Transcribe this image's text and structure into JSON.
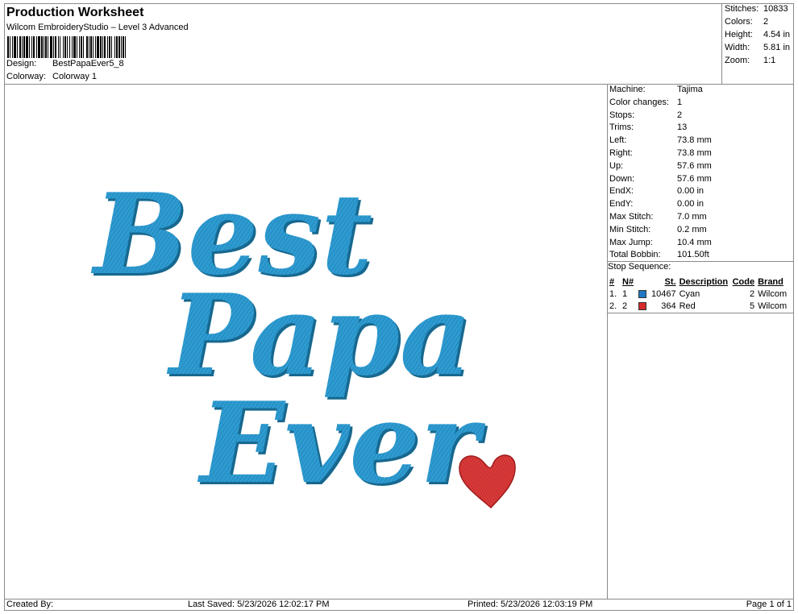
{
  "header": {
    "title": "Production Worksheet",
    "software": "Wilcom EmbroideryStudio – Level 3 Advanced",
    "design_label": "Design:",
    "design_value": "BestPapaEver5_8",
    "colorway_label": "Colorway:",
    "colorway_value": "Colorway 1"
  },
  "summary": {
    "stitches_label": "Stitches:",
    "stitches_value": "10833",
    "colors_label": "Colors:",
    "colors_value": "2",
    "height_label": "Height:",
    "height_value": "4.54 in",
    "width_label": "Width:",
    "width_value": "5.81 in",
    "zoom_label": "Zoom:",
    "zoom_value": "1:1"
  },
  "specs": [
    {
      "label": "Machine:",
      "value": "Tajima"
    },
    {
      "label": "Color changes:",
      "value": "1"
    },
    {
      "label": "Stops:",
      "value": "2"
    },
    {
      "label": "Trims:",
      "value": "13"
    },
    {
      "label": "Left:",
      "value": "73.8 mm"
    },
    {
      "label": "Right:",
      "value": "73.8 mm"
    },
    {
      "label": "Up:",
      "value": "57.6 mm"
    },
    {
      "label": "Down:",
      "value": "57.6 mm"
    },
    {
      "label": "EndX:",
      "value": "0.00 in"
    },
    {
      "label": "EndY:",
      "value": "0.00 in"
    },
    {
      "label": "Max Stitch:",
      "value": "7.0 mm"
    },
    {
      "label": "Min Stitch:",
      "value": "0.2 mm"
    },
    {
      "label": "Max Jump:",
      "value": "10.4 mm"
    },
    {
      "label": "Total Bobbin:",
      "value": "101.50ft"
    }
  ],
  "stop_sequence": {
    "title": "Stop Sequence:",
    "columns": {
      "num": "#",
      "needle": "N#",
      "stitches": "St.",
      "description": "Description",
      "code": "Code",
      "brand": "Brand"
    },
    "rows": [
      {
        "num": "1.",
        "needle": "1",
        "color": "#1f77c4",
        "stitches": "10467",
        "description": "Cyan",
        "code": "2",
        "brand": "Wilcom"
      },
      {
        "num": "2.",
        "needle": "2",
        "color": "#d42a2a",
        "stitches": "364",
        "description": "Red",
        "code": "5",
        "brand": "Wilcom"
      }
    ]
  },
  "design": {
    "line1": "Best",
    "line2": "Papa",
    "line3": "Ever",
    "text_color": "#2e9bd1",
    "text_shadow": "#17688f",
    "heart_color": "#d93a3a",
    "heart_shadow": "#a01c1c"
  },
  "footer": {
    "created_by": "Created By:",
    "last_saved": "Last Saved: 5/23/2026 12:02:17 PM",
    "printed": "Printed: 5/23/2026 12:03:19 PM",
    "page": "Page 1 of 1"
  }
}
